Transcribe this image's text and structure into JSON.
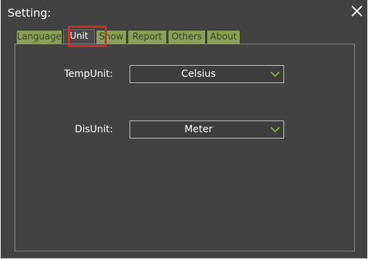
{
  "window": {
    "title": "Setting:"
  },
  "tabs": [
    {
      "label": "Language"
    },
    {
      "label": "Unit"
    },
    {
      "label": "Show"
    },
    {
      "label": "Report"
    },
    {
      "label": "Others"
    },
    {
      "label": "About"
    }
  ],
  "active_tab": "Unit",
  "unit_tab": {
    "temp_unit": {
      "label": "TempUnit:",
      "value": "Celsius"
    },
    "dis_unit": {
      "label": "DisUnit:",
      "value": "Meter"
    }
  },
  "colors": {
    "dialog_bg": "#424242",
    "tab_bg": "#8a9f58",
    "highlight": "#d62a2a",
    "dropdown_arrow": "#7fb03a"
  },
  "icons": {
    "close": "close-icon",
    "dropdown": "chevron-down-icon"
  }
}
